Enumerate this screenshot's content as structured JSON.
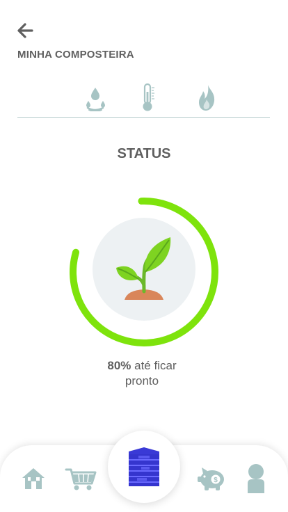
{
  "header": {
    "title": "MINHA COMPOSTEIRA",
    "back_icon": "arrow-left-icon"
  },
  "tabs": [
    {
      "icon": "water-drops-icon"
    },
    {
      "icon": "thermometer-icon"
    },
    {
      "icon": "flame-icon"
    }
  ],
  "status": {
    "title": "STATUS",
    "percent": "80%",
    "progress_fraction": 0.8,
    "text_after_percent": " até ficar",
    "text_line2": "pronto",
    "plant_icon": "sprout-icon"
  },
  "colors": {
    "accent_green": "#7ee30c",
    "icon_teal": "#9dbfbf",
    "composter_blue": "#3a3ad6",
    "text_gray": "#5f5f5f"
  },
  "bottom_nav": {
    "items": [
      {
        "icon": "home-icon"
      },
      {
        "icon": "shopping-cart-icon"
      },
      {
        "icon": "composter-icon"
      },
      {
        "icon": "piggy-bank-icon"
      },
      {
        "icon": "user-icon"
      }
    ]
  }
}
